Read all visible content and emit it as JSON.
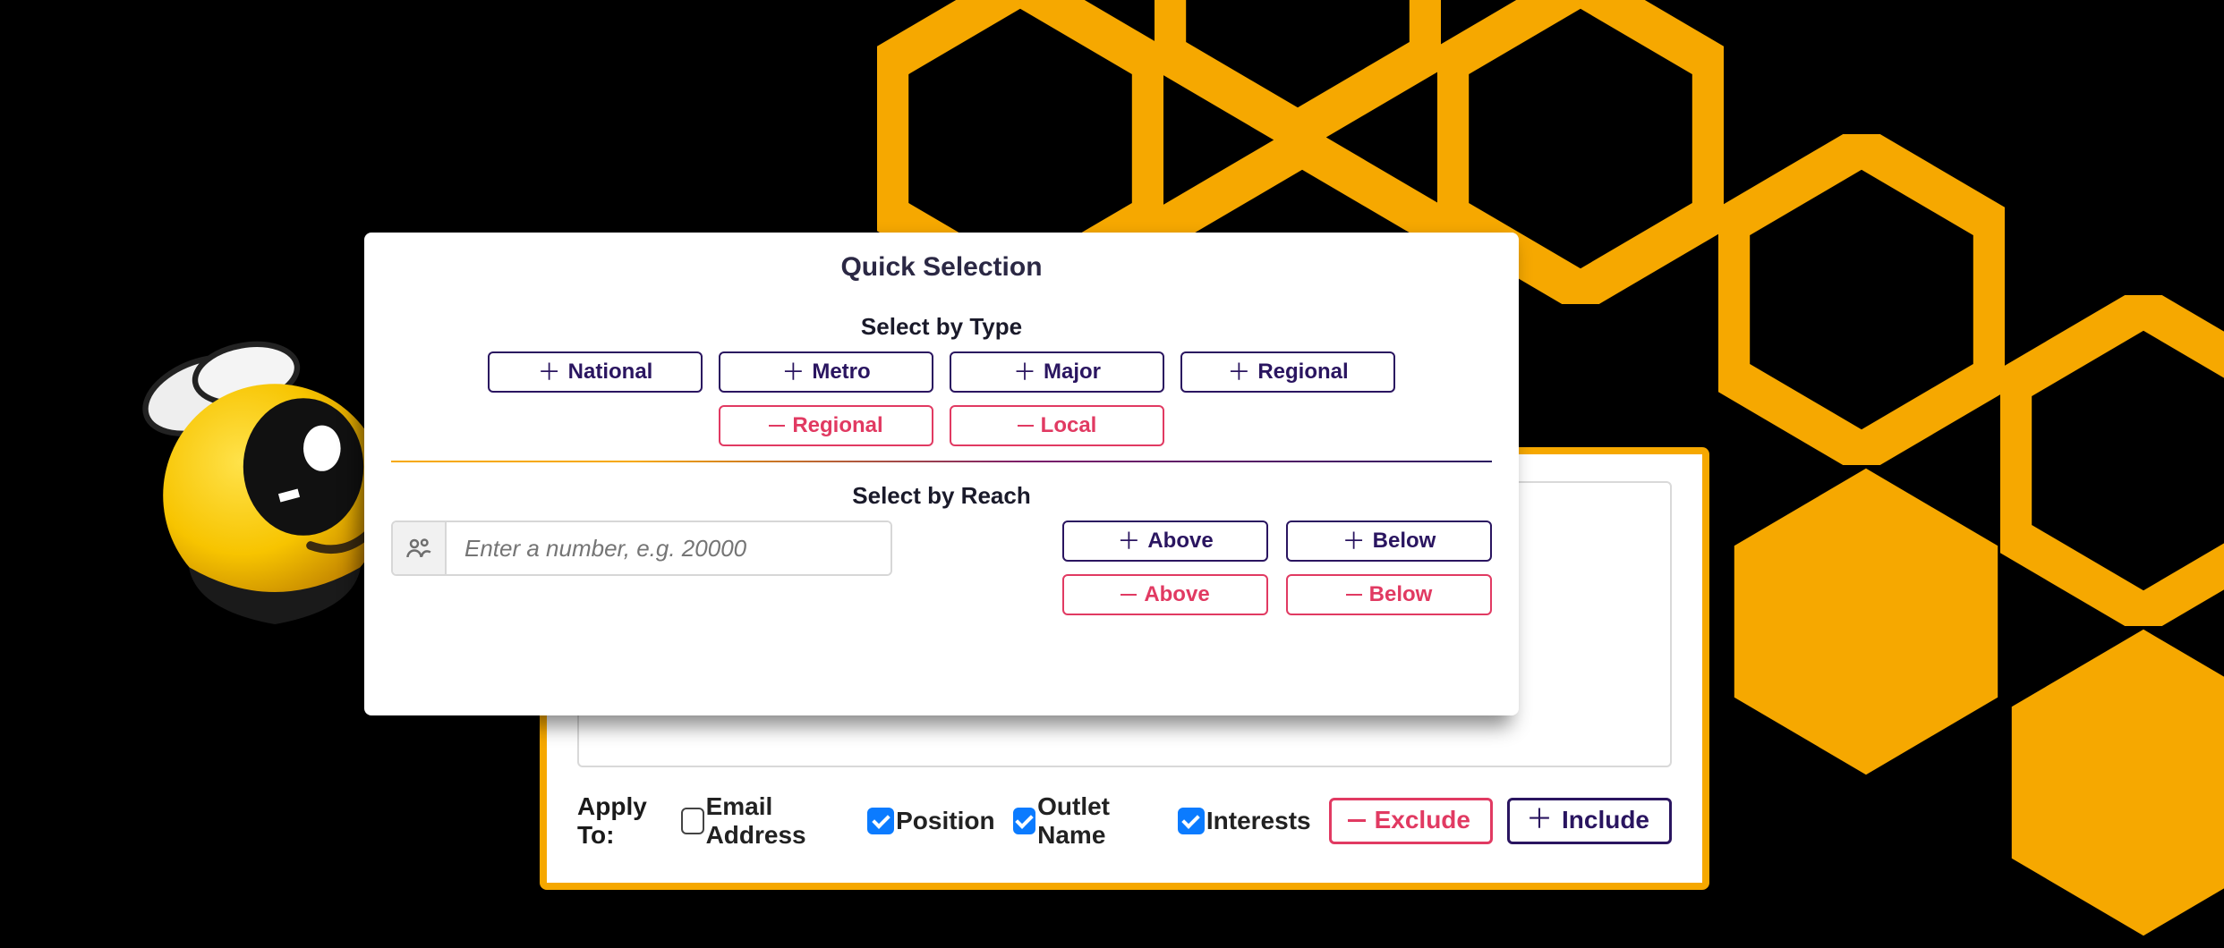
{
  "front": {
    "title": "Quick Selection",
    "select_by_type": {
      "heading": "Select by Type",
      "add": [
        "National",
        "Metro",
        "Major",
        "Regional"
      ],
      "remove": [
        "Regional",
        "Local"
      ]
    },
    "select_by_reach": {
      "heading": "Select by Reach",
      "placeholder": "Enter a number, e.g. 20000",
      "add": [
        "Above",
        "Below"
      ],
      "remove": [
        "Above",
        "Below"
      ]
    }
  },
  "back": {
    "apply_to_label": "Apply To:",
    "checkboxes": [
      {
        "label": "Email Address",
        "checked": false
      },
      {
        "label": "Position",
        "checked": true
      },
      {
        "label": "Outlet Name",
        "checked": true
      },
      {
        "label": "Interests",
        "checked": true
      }
    ],
    "exclude": "Exclude",
    "include": "Include"
  }
}
